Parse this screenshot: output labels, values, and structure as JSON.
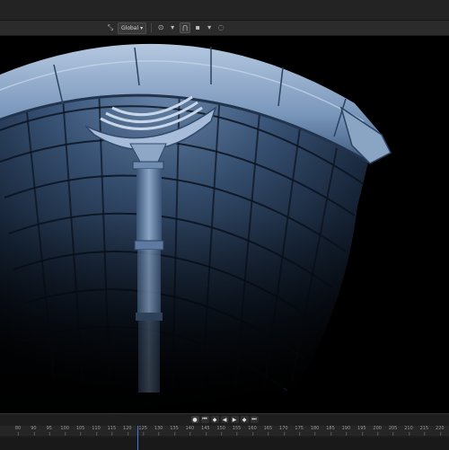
{
  "toolbar": {
    "orientation_label": "Global",
    "orientation_icon": "transform-orientation-icon",
    "pivot_icon": "pivot-point-icon",
    "snap_icon": "snap-magnet-icon",
    "proportional_icon": "proportional-editing-icon"
  },
  "viewport": {
    "scene": "3d-well-shaft-render",
    "dominant_colors": [
      "#0b1220",
      "#2e4a6e",
      "#6f8fb5",
      "#a9bed6"
    ]
  },
  "timeline": {
    "transport_icons": [
      "jump-start-icon",
      "prev-keyframe-icon",
      "play-reverse-icon",
      "play-icon",
      "next-keyframe-icon",
      "jump-end-icon"
    ],
    "frame_ticks": [
      "80",
      "90",
      "95",
      "100",
      "105",
      "110",
      "115",
      "120",
      "125",
      "130",
      "135",
      "140",
      "145",
      "150",
      "155",
      "160",
      "165",
      "170",
      "175",
      "180",
      "185",
      "190",
      "195",
      "200",
      "205",
      "210",
      "215",
      "220"
    ]
  }
}
